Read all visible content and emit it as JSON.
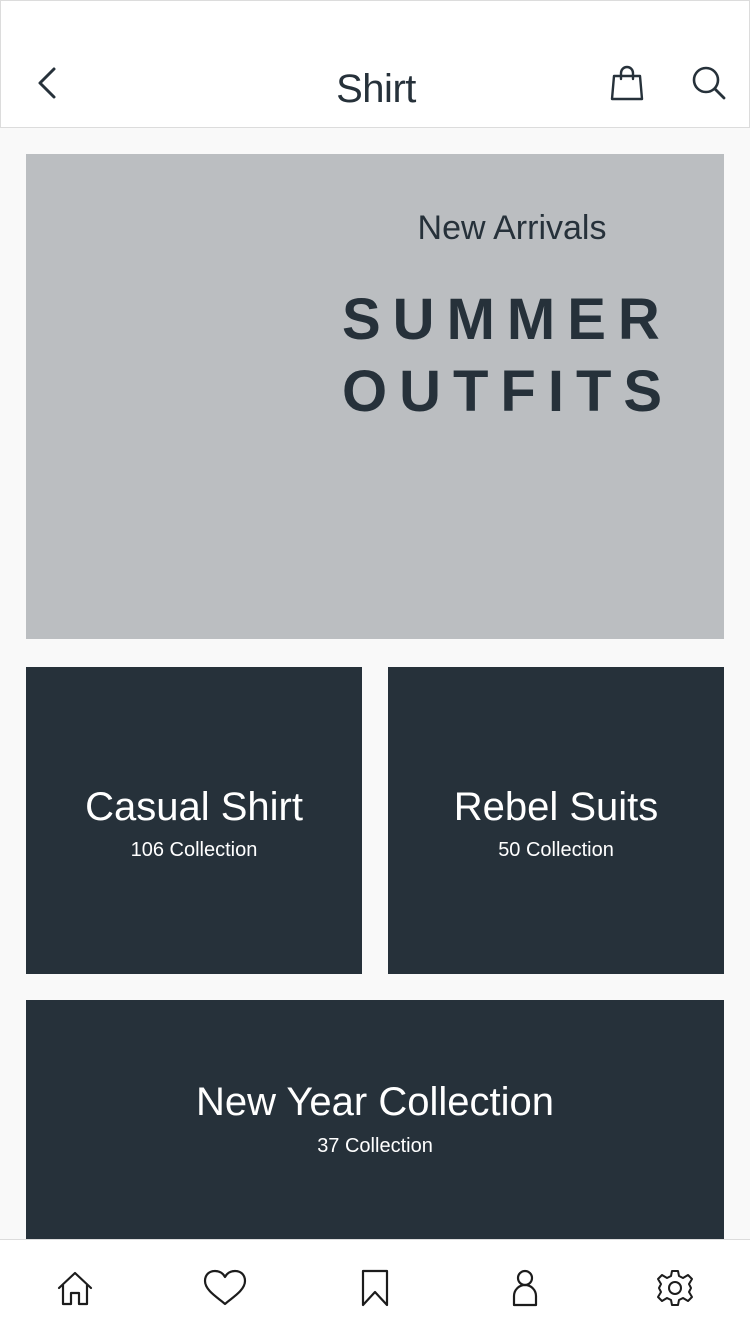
{
  "header": {
    "title": "Shirt",
    "back_icon": "chevron-left-icon",
    "bag_icon": "shopping-bag-icon",
    "search_icon": "search-icon"
  },
  "hero": {
    "subtitle": "New Arrivals",
    "title": "SUMMER\nOUTFITS",
    "background": "#bbbec1"
  },
  "collections": [
    {
      "title": "Casual Shirt",
      "count": "106 Collection"
    },
    {
      "title": "Rebel Suits",
      "count": "50 Collection"
    },
    {
      "title": "New Year Collection",
      "count": "37 Collection"
    }
  ],
  "bottom_nav": {
    "items": [
      {
        "icon": "home-icon"
      },
      {
        "icon": "heart-icon"
      },
      {
        "icon": "bookmark-icon"
      },
      {
        "icon": "user-icon"
      },
      {
        "icon": "gear-icon"
      }
    ]
  },
  "colors": {
    "dark": "#26313a",
    "background": "#f9f9f9",
    "hero": "#bbbec1",
    "border": "#dcdcdc"
  }
}
